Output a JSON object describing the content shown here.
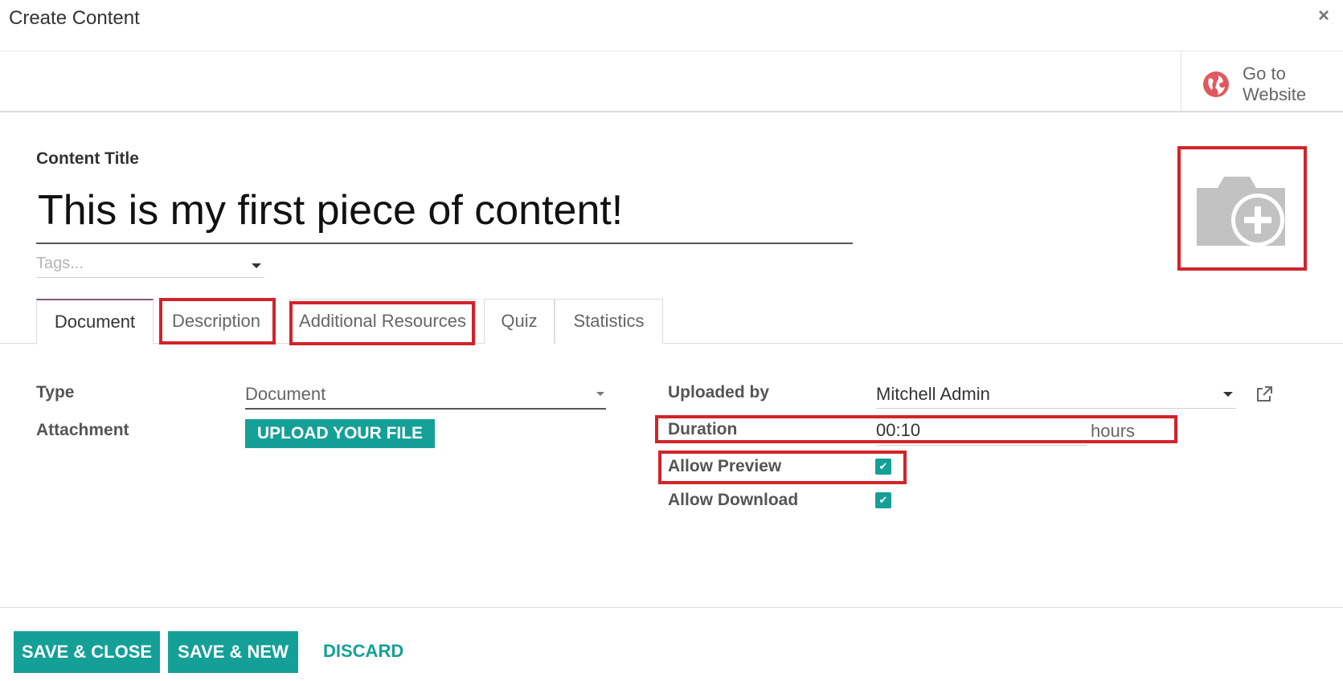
{
  "modal": {
    "title": "Create Content",
    "close_label": "×"
  },
  "button_box": {
    "website_button_line1": "Go to",
    "website_button_line2": "Website",
    "icon": "globe-icon"
  },
  "form": {
    "title_label": "Content Title",
    "title_value": "This is my first piece of content!",
    "tags_placeholder": "Tags...",
    "image_icon": "camera-plus-icon"
  },
  "tabs": [
    {
      "label": "Document",
      "active": true
    },
    {
      "label": "Description",
      "active": false
    },
    {
      "label": "Additional Resources",
      "active": false
    },
    {
      "label": "Quiz",
      "active": false
    },
    {
      "label": "Statistics",
      "active": false
    }
  ],
  "document_tab": {
    "type_label": "Type",
    "type_value": "Document",
    "attachment_label": "Attachment",
    "upload_button": "UPLOAD YOUR FILE",
    "uploaded_by_label": "Uploaded by",
    "uploaded_by_value": "Mitchell Admin",
    "duration_label": "Duration",
    "duration_value": "00:10",
    "duration_unit": "hours",
    "allow_preview_label": "Allow Preview",
    "allow_preview_checked": true,
    "allow_download_label": "Allow Download",
    "allow_download_checked": true
  },
  "footer": {
    "save_close": "SAVE & CLOSE",
    "save_new": "SAVE & NEW",
    "discard": "DISCARD"
  },
  "colors": {
    "accent": "#15a097",
    "highlight": "#d2232a",
    "active_tab": "#875a7b"
  }
}
